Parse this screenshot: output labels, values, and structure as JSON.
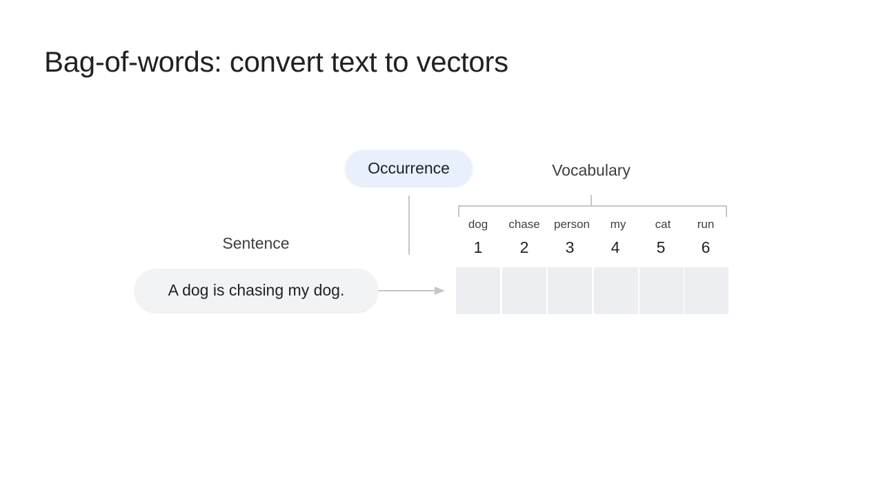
{
  "slide": {
    "title": "Bag-of-words: convert text to vectors"
  },
  "diagram": {
    "occurrence_label": "Occurrence",
    "vocabulary_label": "Vocabulary",
    "sentence_label": "Sentence",
    "sentence_text": "A dog is chasing my dog.",
    "vocabulary": [
      {
        "word": "dog",
        "index": "1"
      },
      {
        "word": "chase",
        "index": "2"
      },
      {
        "word": "person",
        "index": "3"
      },
      {
        "word": "my",
        "index": "4"
      },
      {
        "word": "cat",
        "index": "5"
      },
      {
        "word": "run",
        "index": "6"
      }
    ],
    "vector_values": [
      "",
      "",
      "",
      "",
      "",
      ""
    ]
  },
  "colors": {
    "occurrence_pill": "#e8f0fe",
    "sentence_pill": "#f1f3f4",
    "vector_cell": "#eceef1",
    "connector": "#c4c7c5",
    "text": "#202124"
  }
}
